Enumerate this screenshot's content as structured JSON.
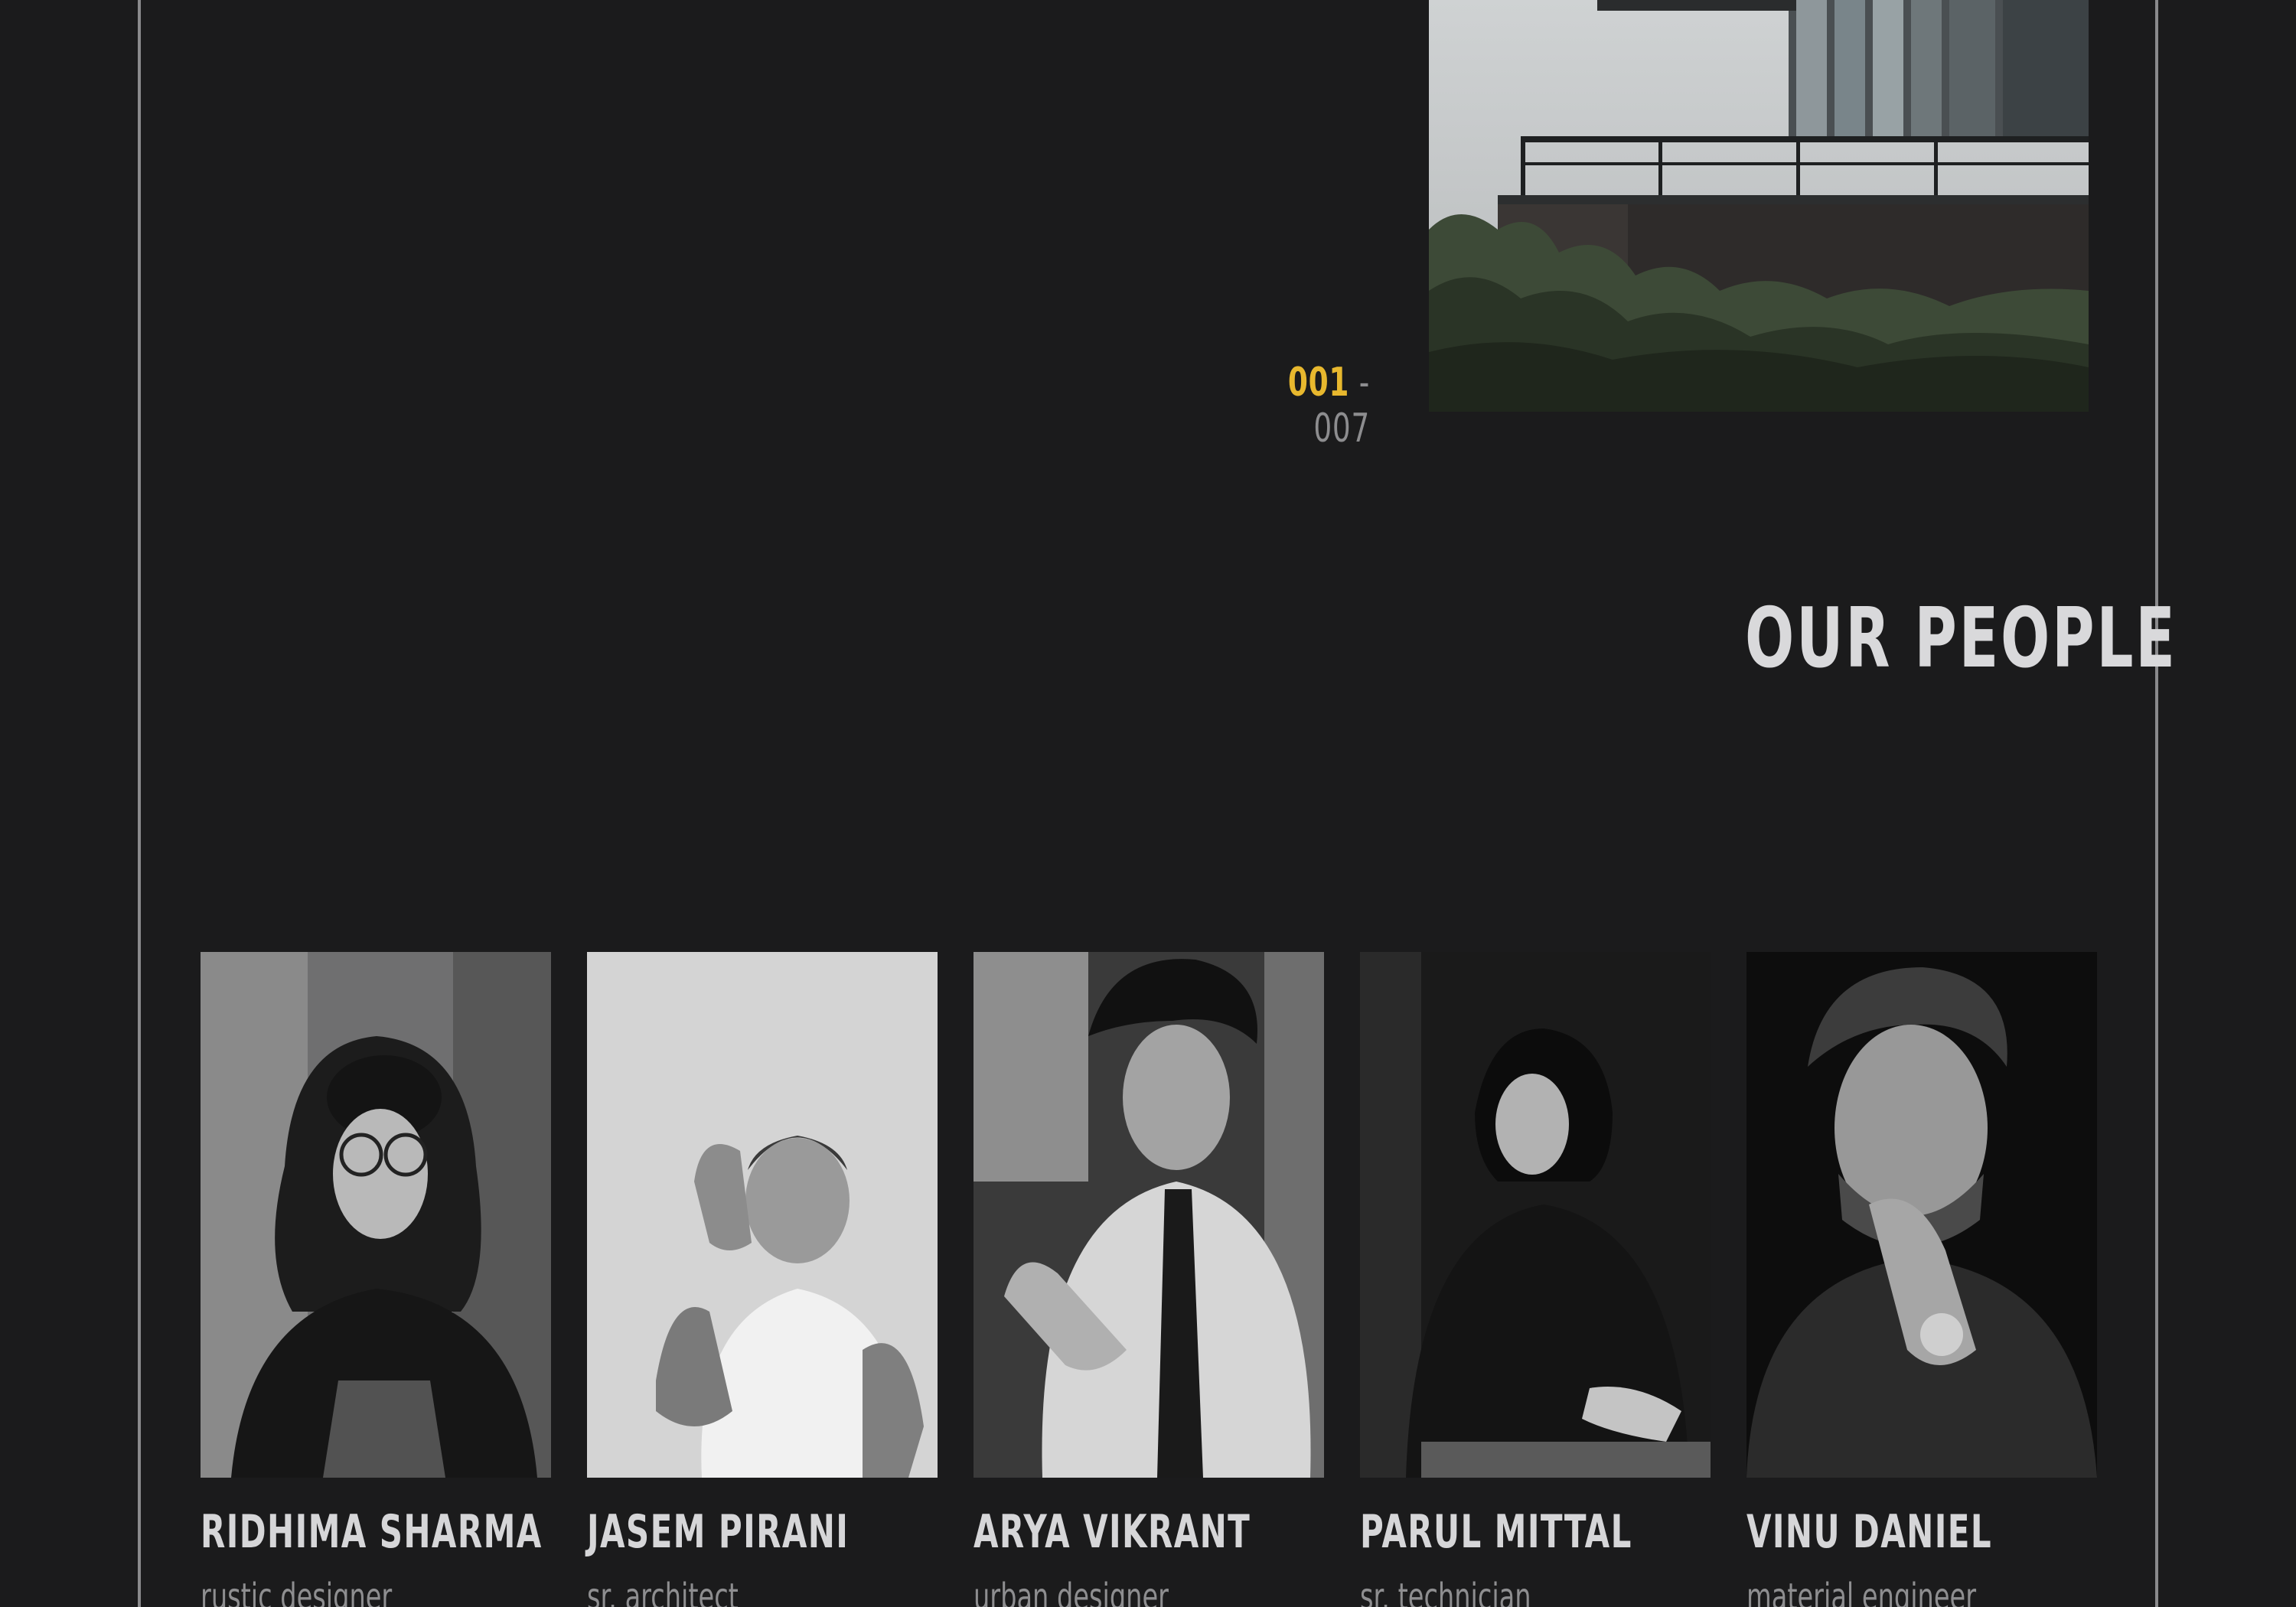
{
  "slider": {
    "current": "001",
    "separator": "-",
    "total": "007"
  },
  "section": {
    "title": "OUR PEOPLE"
  },
  "people": [
    {
      "name": "RIDHIMA SHARMA",
      "role": "rustic designer"
    },
    {
      "name": "JASEM PIRANI",
      "role": "sr. architect"
    },
    {
      "name": "ARYA VIKRANT",
      "role": "urban designer"
    },
    {
      "name": "PARUL MITTAL",
      "role": "sr. technician"
    },
    {
      "name": "VINU DANIEL",
      "role": "material engineer"
    }
  ],
  "colors": {
    "background": "#1b1b1c",
    "accent": "#e8b82e",
    "frame_line": "#8a8a8c",
    "title_text": "#d9d9db",
    "muted_text": "#8e8e90"
  }
}
